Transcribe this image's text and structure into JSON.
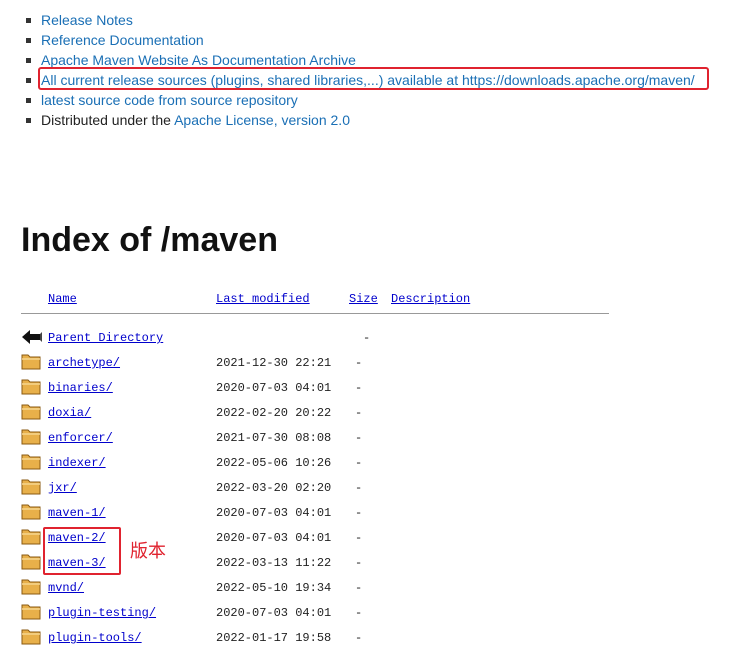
{
  "links": [
    {
      "text": "Release Notes"
    },
    {
      "text": "Reference Documentation"
    },
    {
      "text": "Apache Maven Website As Documentation Archive"
    },
    {
      "text": "All current release sources (plugins, shared libraries,...) available at https://downloads.apache.org/maven/"
    },
    {
      "text": "latest source code from source repository"
    },
    {
      "prefix": "Distributed under the ",
      "text": "Apache License, version 2.0"
    }
  ],
  "heading": "Index of /maven",
  "table": {
    "headers": {
      "name": "Name",
      "modified": "Last modified",
      "size": "Size",
      "description": "Description"
    },
    "parent": {
      "name": "Parent Directory",
      "size": "-"
    },
    "rows": [
      {
        "name": "archetype/",
        "modified": "2021-12-30 22:21",
        "size": "-"
      },
      {
        "name": "binaries/",
        "modified": "2020-07-03 04:01",
        "size": "-"
      },
      {
        "name": "doxia/",
        "modified": "2022-02-20 20:22",
        "size": "-"
      },
      {
        "name": "enforcer/",
        "modified": "2021-07-30 08:08",
        "size": "-"
      },
      {
        "name": "indexer/",
        "modified": "2022-05-06 10:26",
        "size": "-"
      },
      {
        "name": "jxr/",
        "modified": "2022-03-20 02:20",
        "size": "-"
      },
      {
        "name": "maven-1/",
        "modified": "2020-07-03 04:01",
        "size": "-"
      },
      {
        "name": "maven-2/",
        "modified": "2020-07-03 04:01",
        "size": "-"
      },
      {
        "name": "maven-3/",
        "modified": "2022-03-13 11:22",
        "size": "-"
      },
      {
        "name": "mvnd/",
        "modified": "2022-05-10 19:34",
        "size": "-"
      },
      {
        "name": "plugin-testing/",
        "modified": "2020-07-03 04:01",
        "size": "-"
      },
      {
        "name": "plugin-tools/",
        "modified": "2022-01-17 19:58",
        "size": "-"
      }
    ]
  },
  "annotation": {
    "label": "版本",
    "color": "#e0232f"
  },
  "colors": {
    "link": "#1a6fb5",
    "listing_link": "#0000cc",
    "highlight": "#e0232f",
    "folder": "#e8b04a"
  }
}
